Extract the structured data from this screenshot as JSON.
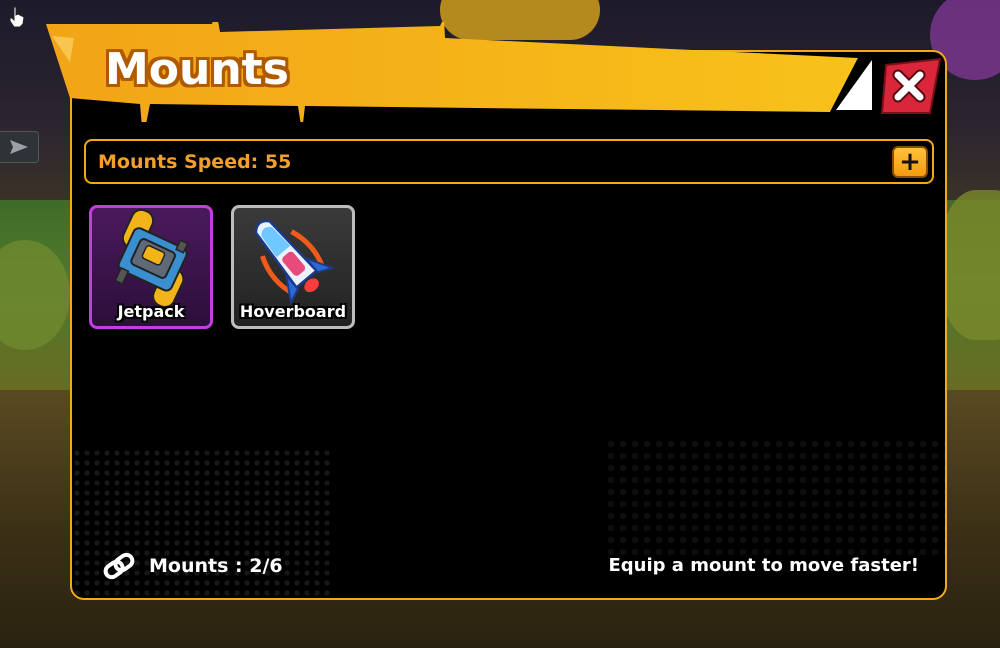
{
  "window": {
    "title": "Mounts"
  },
  "speed": {
    "label": "Mounts Speed: 55",
    "add_button": "+"
  },
  "mounts": [
    {
      "name": "Jetpack",
      "icon": "jetpack-icon",
      "selected": true,
      "border_color": "#c23ee0"
    },
    {
      "name": "Hoverboard",
      "icon": "hoverboard-icon",
      "selected": false,
      "border_color": "#bdbdbd"
    }
  ],
  "footer": {
    "count": "Mounts : 2/6",
    "hint": "Equip a mount to move faster!"
  },
  "colors": {
    "accent": "#f2a918",
    "close": "#d9263a",
    "speed_text": "#f2a02a"
  }
}
